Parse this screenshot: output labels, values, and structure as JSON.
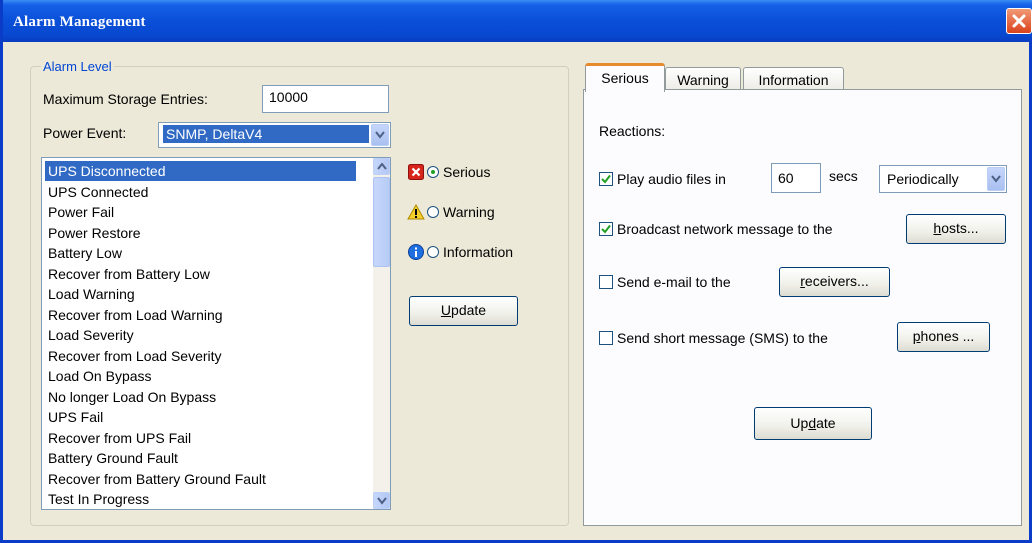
{
  "window": {
    "title": "Alarm Management"
  },
  "alarm_level": {
    "legend": "Alarm Level",
    "max_storage_label": "Maximum Storage Entries:",
    "max_storage_value": "10000",
    "power_event_label": "Power Event:",
    "power_event_value": "SNMP, DeltaV4",
    "events": [
      "UPS Disconnected",
      "UPS Connected",
      "Power Fail",
      "Power Restore",
      "Battery Low",
      "Recover from Battery Low",
      "Load Warning",
      "Recover from Load Warning",
      "Load Severity",
      "Recover from Load Severity",
      "Load On Bypass",
      "No longer Load On Bypass",
      "UPS Fail",
      "Recover from UPS Fail",
      "Battery Ground Fault",
      "Recover from Battery Ground Fault",
      "Test In Progress"
    ],
    "selected_event": "UPS Disconnected",
    "levels": {
      "serious": "Serious",
      "warning": "Warning",
      "information": "Information",
      "selected": "Serious"
    },
    "update_button": {
      "pre": "",
      "mnemonic": "U",
      "post": "pdate"
    }
  },
  "tabs": {
    "items": [
      "Serious",
      "Warning",
      "Information"
    ],
    "active": "Serious"
  },
  "reactions": {
    "heading": "Reactions:",
    "play_audio": {
      "checked": true,
      "label": "Play audio files in",
      "interval": "60",
      "unit": "secs",
      "mode": "Periodically"
    },
    "broadcast": {
      "checked": true,
      "label": "Broadcast network message to the",
      "button": {
        "pre": "",
        "mnemonic": "h",
        "post": "osts..."
      }
    },
    "email": {
      "checked": false,
      "label": "Send e-mail to the",
      "button": {
        "pre": "",
        "mnemonic": "r",
        "post": "eceivers..."
      }
    },
    "sms": {
      "checked": false,
      "label": "Send short message (SMS) to the",
      "button": {
        "pre": "",
        "mnemonic": "p",
        "post": "hones ..."
      }
    },
    "update_button": {
      "pre": "Up",
      "mnemonic": "d",
      "post": "ate"
    }
  },
  "icons": {
    "close": "close-icon",
    "serious": "error-icon",
    "warning": "warning-icon",
    "information": "info-icon",
    "dropdown": "chevron-down-icon",
    "scroll_up": "chevron-up-icon",
    "scroll_down": "chevron-down-icon",
    "check": "check-icon"
  },
  "colors": {
    "title_bar": "#0a4fd8",
    "selection": "#316ac5",
    "legend_text": "#0046d5",
    "active_tab_accent": "#e68b2c",
    "close_button": "#d9421c"
  }
}
